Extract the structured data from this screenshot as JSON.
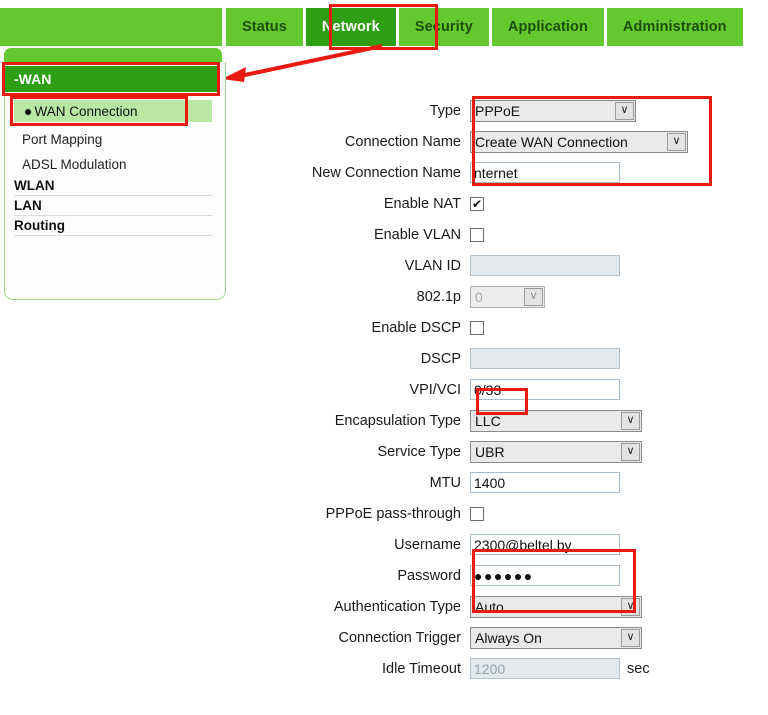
{
  "nav": {
    "tabs": [
      {
        "label": "Status",
        "active": false
      },
      {
        "label": "Network",
        "active": true
      },
      {
        "label": "Security",
        "active": false
      },
      {
        "label": "Application",
        "active": false
      },
      {
        "label": "Administration",
        "active": false
      }
    ]
  },
  "sidebar": {
    "section": "-WAN",
    "selected": "WAN Connection",
    "items": [
      {
        "label": "Port Mapping"
      },
      {
        "label": "ADSL Modulation"
      }
    ],
    "groups": [
      {
        "label": "WLAN"
      },
      {
        "label": "LAN"
      },
      {
        "label": "Routing"
      }
    ]
  },
  "form": {
    "type": {
      "label": "Type",
      "value": "PPPoE"
    },
    "connection_name": {
      "label": "Connection Name",
      "value": "Create WAN Connection"
    },
    "new_connection_name": {
      "label": "New Connection Name",
      "value": "nternet"
    },
    "enable_nat": {
      "label": "Enable NAT",
      "checked": "✔"
    },
    "enable_vlan": {
      "label": "Enable VLAN",
      "checked": ""
    },
    "vlan_id": {
      "label": "VLAN ID",
      "value": ""
    },
    "p8021p": {
      "label": "802.1p",
      "value": "0"
    },
    "enable_dscp": {
      "label": "Enable DSCP",
      "checked": ""
    },
    "dscp": {
      "label": "DSCP",
      "value": ""
    },
    "vpi_vci": {
      "label": "VPI/VCI",
      "value": "0/33"
    },
    "encapsulation_type": {
      "label": "Encapsulation Type",
      "value": "LLC"
    },
    "service_type": {
      "label": "Service Type",
      "value": "UBR"
    },
    "mtu": {
      "label": "MTU",
      "value": "1400"
    },
    "pppoe_pass_through": {
      "label": "PPPoE pass-through",
      "checked": ""
    },
    "username": {
      "label": "Username",
      "value": "2300@beltel.by"
    },
    "password": {
      "label": "Password",
      "value": "●●●●●●"
    },
    "authentication_type": {
      "label": "Authentication Type",
      "value": "Auto"
    },
    "connection_trigger": {
      "label": "Connection Trigger",
      "value": "Always On"
    },
    "idle_timeout": {
      "label": "Idle Timeout",
      "value": "1200",
      "unit": "sec"
    }
  },
  "icons": {
    "chevron_down": "∨",
    "bullet": "●"
  },
  "colors": {
    "nav_green": "#63c92f",
    "active_green": "#2e9e14",
    "highlight_red": "#e81a12",
    "selected_item_green": "#b9e8a5"
  }
}
